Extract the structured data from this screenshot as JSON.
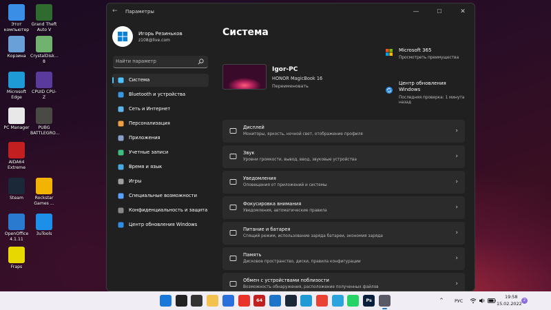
{
  "desktop": {
    "icons": [
      {
        "label": "Этот\nкомпьютер",
        "icon": "monitor-icon",
        "color": "#3a8ee6"
      },
      {
        "label": "Grand Theft\nAuto V",
        "icon": "gta-icon",
        "color": "#2f6b2f"
      },
      {
        "label": "Корзина",
        "icon": "recycle-bin-icon",
        "color": "#6aa0d8"
      },
      {
        "label": "CrystalDisk...\n8",
        "icon": "crystaldisk-icon",
        "color": "#6fb36f"
      },
      {
        "label": "Microsoft\nEdge",
        "icon": "edge-icon",
        "color": "#1e9bd7"
      },
      {
        "label": "CPUID CPU-Z",
        "icon": "cpuz-icon",
        "color": "#5a3a9a"
      },
      {
        "label": "PC Manager",
        "icon": "pc-manager-icon",
        "color": "#e8e8e8"
      },
      {
        "label": "PUBG\nBATTLEGRO...",
        "icon": "pubg-icon",
        "color": "#4a4a44"
      },
      {
        "label": "AIDA64\nExtreme",
        "icon": "aida64-icon",
        "color": "#c22020"
      },
      {
        "label": "Steam",
        "icon": "steam-icon",
        "color": "#1b2838"
      },
      {
        "label": "Rockstar\nGames ...",
        "icon": "rockstar-icon",
        "color": "#f2b400"
      },
      {
        "label": "OpenOffice\n4.1.11",
        "icon": "openoffice-icon",
        "color": "#2a7ad0"
      },
      {
        "label": "3uTools",
        "icon": "3utools-icon",
        "color": "#1c8fe8"
      },
      {
        "label": "Fraps",
        "icon": "fraps-icon",
        "color": "#e6d800"
      }
    ]
  },
  "window": {
    "title": "Параметры",
    "minimize": "—",
    "maximize": "☐",
    "close": "✕"
  },
  "profile": {
    "name": "Игорь Резиньков",
    "email": "z108@live.com"
  },
  "search": {
    "placeholder": "Найти параметр"
  },
  "nav": {
    "items": [
      {
        "label": "Система",
        "icon": "system-icon",
        "color": "#4cc2ff"
      },
      {
        "label": "Bluetooth и устройства",
        "icon": "bluetooth-icon",
        "color": "#3a96dd"
      },
      {
        "label": "Сеть и Интернет",
        "icon": "network-icon",
        "color": "#5fb3e8"
      },
      {
        "label": "Персонализация",
        "icon": "personalization-icon",
        "color": "#f0a040"
      },
      {
        "label": "Приложения",
        "icon": "apps-icon",
        "color": "#8aa0c8"
      },
      {
        "label": "Учетные записи",
        "icon": "accounts-icon",
        "color": "#3fbf7f"
      },
      {
        "label": "Время и язык",
        "icon": "time-language-icon",
        "color": "#4aa8e0"
      },
      {
        "label": "Игры",
        "icon": "games-icon",
        "color": "#a0a0a0"
      },
      {
        "label": "Специальные возможности",
        "icon": "accessibility-icon",
        "color": "#5aa0ff"
      },
      {
        "label": "Конфиденциальность и защита",
        "icon": "privacy-shield-icon",
        "color": "#888888"
      },
      {
        "label": "Центр обновления Windows",
        "icon": "windows-update-icon",
        "color": "#2f8de4"
      }
    ]
  },
  "main": {
    "title": "Система",
    "device": {
      "name": "Igor-PC",
      "model": "HONOR MagicBook 16",
      "rename": "Переименовать"
    },
    "promos": [
      {
        "title": "Microsoft 365",
        "subtitle": "Просмотреть преимущества",
        "icon": "microsoft-365-icon"
      },
      {
        "title": "Центр обновления\nWindows",
        "subtitle": "Последняя проверка: 1 минута\nназад",
        "icon": "windows-update-icon"
      }
    ],
    "cards": [
      {
        "title": "Дисплей",
        "subtitle": "Мониторы, яркость, ночной свет, отображение профиля",
        "icon": "display-icon"
      },
      {
        "title": "Звук",
        "subtitle": "Уровни громкости, вывод, ввод, звуковые устройства",
        "icon": "sound-icon"
      },
      {
        "title": "Уведомления",
        "subtitle": "Оповещения от приложений и системы",
        "icon": "notifications-icon"
      },
      {
        "title": "Фокусировка внимания",
        "subtitle": "Уведомления, автоматические правила",
        "icon": "focus-assist-icon"
      },
      {
        "title": "Питание и батарея",
        "subtitle": "Спящий режим, использование заряда батареи, экономия заряда",
        "icon": "power-icon"
      },
      {
        "title": "Память",
        "subtitle": "Дисковое пространство, диски, правила конфигурации",
        "icon": "storage-icon"
      },
      {
        "title": "Обмен с устройствами поблизости",
        "subtitle": "Возможность обнаружения, расположение полученных файлов",
        "icon": "nearby-sharing-icon"
      }
    ],
    "chevron": "›"
  },
  "taskbar": {
    "apps": [
      {
        "icon": "start-icon",
        "color": "#1a78d8"
      },
      {
        "icon": "search-icon",
        "color": "#222222"
      },
      {
        "icon": "task-view-icon",
        "color": "#333333"
      },
      {
        "icon": "file-explorer-icon",
        "color": "#f2c14e"
      },
      {
        "icon": "store-icon",
        "color": "#2a6fdb"
      },
      {
        "icon": "yandex-browser-icon",
        "color": "#e8322a"
      },
      {
        "icon": "aida64-icon",
        "color": "#c22020"
      },
      {
        "icon": "remote-desktop-icon",
        "color": "#1d74c9"
      },
      {
        "icon": "steam-icon",
        "color": "#1b2838"
      },
      {
        "icon": "edge-icon",
        "color": "#1e9bd7"
      },
      {
        "icon": "chrome-icon",
        "color": "#e94335"
      },
      {
        "icon": "telegram-icon",
        "color": "#2aa3df"
      },
      {
        "icon": "whatsapp-icon",
        "color": "#25d366"
      },
      {
        "icon": "photoshop-icon",
        "color": "#0a1f3c"
      },
      {
        "icon": "settings-icon",
        "color": "#5a5a66"
      }
    ],
    "aida_label": "64",
    "ps_label": "Ps",
    "tray": {
      "chevron": "^",
      "language": "РУС",
      "time": "19:58",
      "date": "15.02.2022",
      "notification_count": "2"
    }
  }
}
